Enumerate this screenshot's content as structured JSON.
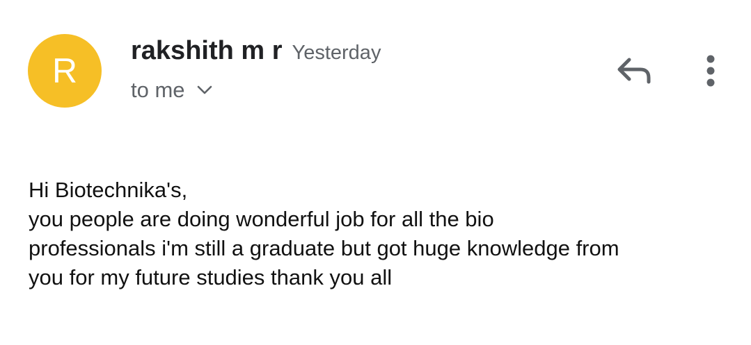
{
  "email": {
    "avatar_letter": "R",
    "avatar_color": "#f6bf26",
    "sender_name": "rakshith m r",
    "timestamp": "Yesterday",
    "recipient": "to me",
    "recipient_toggle_icon": "chevron-down-icon",
    "actions": {
      "reply_icon": "reply-icon",
      "more_icon": "more-vert-icon"
    },
    "body_lines": [
      "Hi Biotechnika's,",
      "you people are doing wonderful job for all the bio",
      "professionals i'm still a graduate but got huge knowledge from",
      "you for my future studies thank you all"
    ]
  }
}
